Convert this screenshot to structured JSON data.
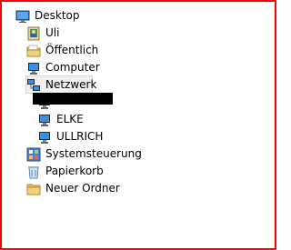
{
  "tree": {
    "root": {
      "label": "Desktop",
      "icon": "desktop-icon"
    },
    "items": [
      {
        "label": "Uli",
        "icon": "user-folder-icon"
      },
      {
        "label": "Öffentlich",
        "icon": "folder-icon"
      },
      {
        "label": "Computer",
        "icon": "computer-icon"
      },
      {
        "label": "Netzwerk",
        "icon": "network-icon",
        "selected": true,
        "children": [
          {
            "label": "",
            "icon": "computer-icon",
            "redacted": true
          },
          {
            "label": "ELKE",
            "icon": "computer-icon"
          },
          {
            "label": "ULLRICH",
            "icon": "computer-icon"
          }
        ]
      },
      {
        "label": "Systemsteuerung",
        "icon": "control-panel-icon"
      },
      {
        "label": "Papierkorb",
        "icon": "recycle-bin-icon"
      },
      {
        "label": "Neuer Ordner",
        "icon": "folder-icon"
      }
    ]
  },
  "colors": {
    "frame_border": "#ff0000",
    "selection_background": "#f0f0f0",
    "selection_border": "#d9d9d9",
    "redaction": "#000000"
  }
}
